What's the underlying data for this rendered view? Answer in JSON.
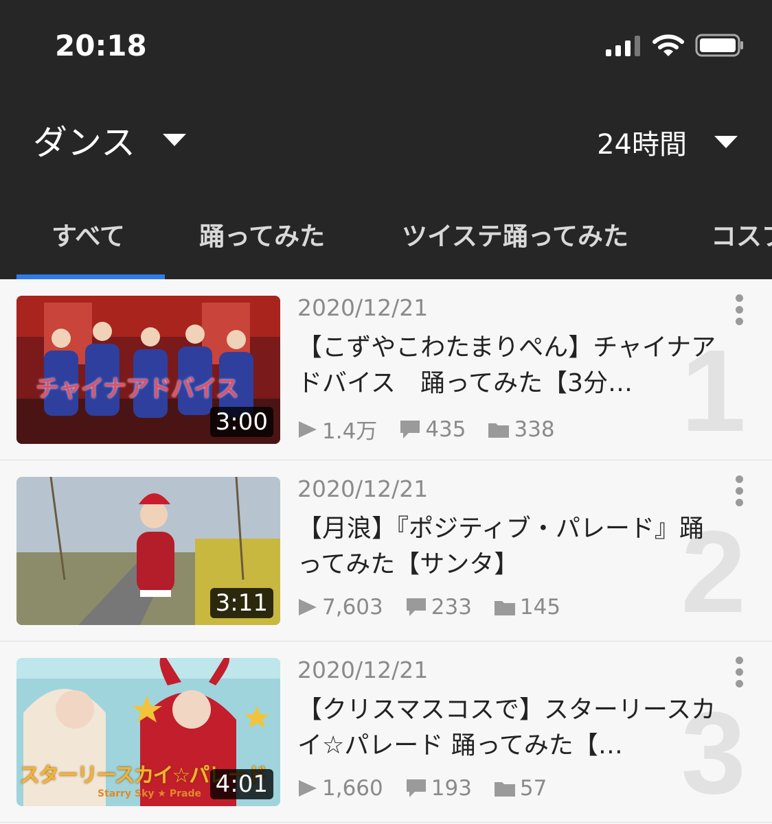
{
  "status": {
    "time": "20:18"
  },
  "filters": {
    "genre": "ダンス",
    "period": "24時間"
  },
  "tabs": [
    {
      "label": "すべて"
    },
    {
      "label": "踊ってみた"
    },
    {
      "label": "ツイステ踊ってみた"
    },
    {
      "label": "コスプ"
    }
  ],
  "colors": {
    "accent": "#2e7be9",
    "header_bg": "#262626"
  },
  "videos": [
    {
      "rank": "1",
      "date": "2020/12/21",
      "title": "【こずやこわたまりぺん】チャイナアドバイス　踊ってみた【3分…",
      "duration": "3:00",
      "views": "1.4万",
      "comments": "435",
      "mylists": "338",
      "thumb_overlay": "チャイナアドバイス"
    },
    {
      "rank": "2",
      "date": "2020/12/21",
      "title": "【月浪】『ポジティブ・パレード』踊ってみた【サンタ】",
      "duration": "3:11",
      "views": "7,603",
      "comments": "233",
      "mylists": "145",
      "thumb_overlay": ""
    },
    {
      "rank": "3",
      "date": "2020/12/21",
      "title": "【クリスマスコスで】スターリースカイ☆パレード 踊ってみた【…",
      "duration": "4:01",
      "views": "1,660",
      "comments": "193",
      "mylists": "57",
      "thumb_overlay": "スターリースカイ☆パレード",
      "thumb_overlay_sub": "Starry Sky ★ Prade"
    }
  ]
}
